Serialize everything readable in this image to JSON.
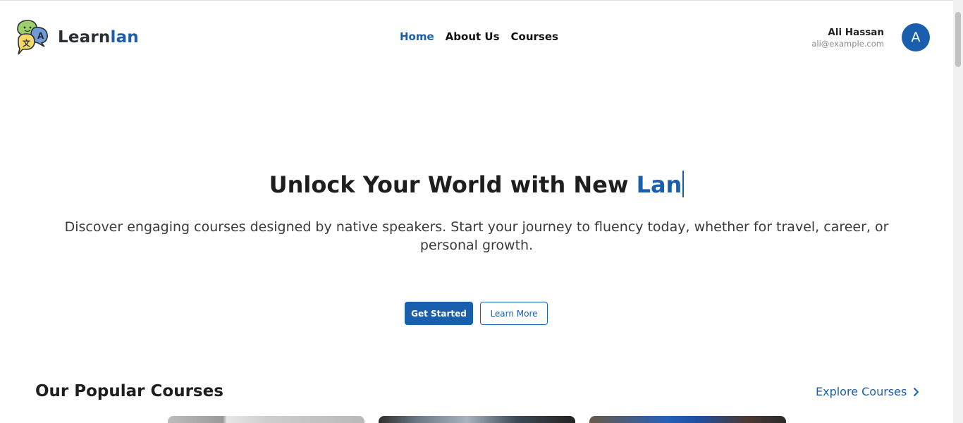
{
  "brand": {
    "name_part1": "Learn",
    "name_part2": "lan",
    "accent_color": "#1a5fae"
  },
  "nav": {
    "items": [
      {
        "label": "Home",
        "active": true
      },
      {
        "label": "About Us",
        "active": false
      },
      {
        "label": "Courses",
        "active": false
      }
    ]
  },
  "user": {
    "name": "Ali Hassan",
    "email": "ali@example.com",
    "avatar_initial": "A"
  },
  "hero": {
    "title_static": "Unlock Your World with New ",
    "title_typed": "Lan",
    "subtitle": "Discover engaging courses designed by native speakers. Start your journey to fluency today, whether for travel, career, or personal growth.",
    "primary_button": "Get Started",
    "secondary_button": "Learn More"
  },
  "popular": {
    "title": "Our Popular Courses",
    "explore_label": "Explore Courses",
    "explore_icon": "chevron-right-icon"
  }
}
